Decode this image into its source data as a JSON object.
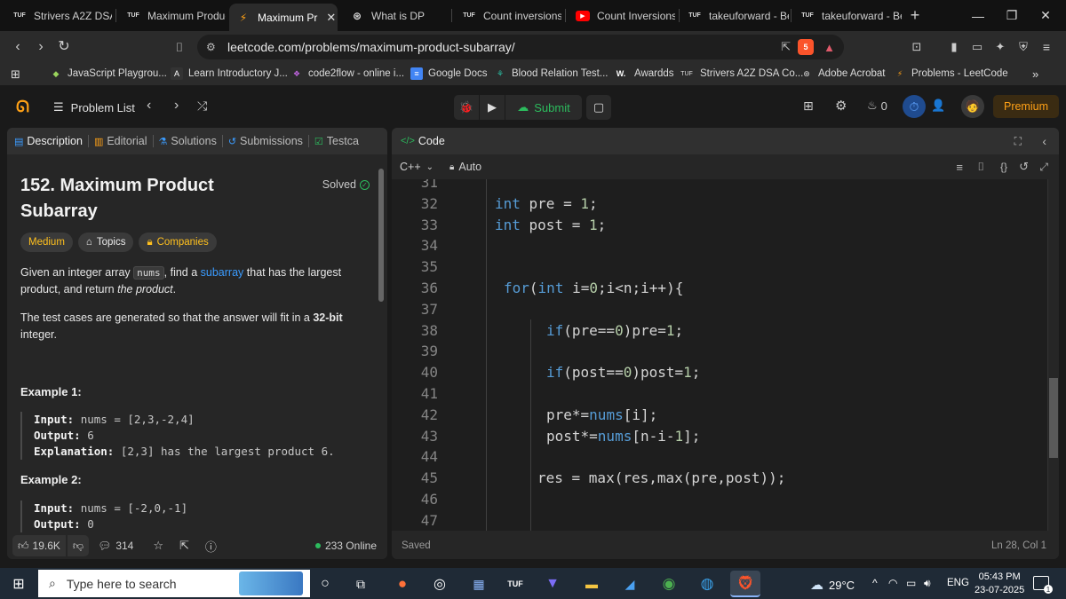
{
  "browser": {
    "tabs": [
      {
        "label": "Strivers A2Z DSA C",
        "favicon": "TUF"
      },
      {
        "label": "Maximum Produc",
        "favicon": "TUF"
      },
      {
        "label": "Maximum Pr",
        "favicon": "leetcode",
        "active": true
      },
      {
        "label": "What is DP",
        "favicon": "chatgpt"
      },
      {
        "label": "Count inversions",
        "favicon": "TUF"
      },
      {
        "label": "Count Inversions",
        "favicon": "youtube"
      },
      {
        "label": "takeuforward - Be",
        "favicon": "TUF"
      },
      {
        "label": "takeuforward - Be",
        "favicon": "TUF"
      }
    ],
    "tab_close": "✕",
    "new_tab": "+",
    "window_controls": {
      "minimize": "—",
      "restore": "❐",
      "close": "✕"
    },
    "url": "leetcode.com/problems/maximum-product-subarray/",
    "brave_badge": "5",
    "bookmarks": [
      {
        "label": "JavaScript Playgrou...",
        "icon": "js"
      },
      {
        "label": "Learn Introductory J...",
        "icon": "A"
      },
      {
        "label": "code2flow - online i...",
        "icon": "c2f"
      },
      {
        "label": "Google Docs",
        "icon": "docs"
      },
      {
        "label": "Blood Relation Test...",
        "icon": "br"
      },
      {
        "label": "Awardds",
        "icon": "W."
      },
      {
        "label": "Strivers A2Z DSA Co...",
        "icon": "TUF"
      },
      {
        "label": "Adobe Acrobat",
        "icon": "acrobat"
      },
      {
        "label": "Problems - LeetCode",
        "icon": "leetcode"
      }
    ],
    "bookmarks_more": "»"
  },
  "lc_header": {
    "problem_list": "Problem List",
    "submit": "Submit",
    "fire_count": "0",
    "premium": "Premium"
  },
  "left_panel": {
    "tabs": [
      {
        "label": "Description",
        "icon": "description"
      },
      {
        "label": "Editorial",
        "icon": "book"
      },
      {
        "label": "Solutions",
        "icon": "flask"
      },
      {
        "label": "Submissions",
        "icon": "history"
      },
      {
        "label": "Testca",
        "icon": "check"
      }
    ],
    "title_line1": "152. Maximum Product",
    "title_line2": "Subarray",
    "solved": "Solved",
    "tags": {
      "difficulty": "Medium",
      "topics": "Topics",
      "companies": "Companies"
    },
    "desc_p1_a": "Given an integer array ",
    "desc_p1_code": "nums",
    "desc_p1_b": ", find a ",
    "desc_p1_link": "subarray",
    "desc_p1_c": " that has the largest",
    "desc_p1_d": "product, and return ",
    "desc_p1_e": "the product",
    "desc_p1_f": ".",
    "desc_p2_a": "The test cases are generated so that the answer will fit in a ",
    "desc_p2_b": "32-bit",
    "desc_p2_c": "integer.",
    "example1": {
      "title": "Example 1:",
      "input_label": "Input:",
      "input_value": "nums = [2,3,-2,4]",
      "output_label": "Output:",
      "output_value": "6",
      "explanation_label": "Explanation:",
      "explanation_value": "[2,3] has the largest product 6."
    },
    "example2": {
      "title": "Example 2:",
      "input_label": "Input:",
      "input_value": "nums = [-2,0,-1]",
      "output_label": "Output:",
      "output_value": "0"
    },
    "footer": {
      "likes": "19.6K",
      "comments": "314",
      "online": "233 Online"
    }
  },
  "right_panel": {
    "tab": "Code",
    "language": "C++",
    "mode": "Auto",
    "status": "Saved",
    "cursor": "Ln 28, Col 1",
    "code_lines": [
      {
        "n": "31",
        "text": ""
      },
      {
        "n": "32",
        "text": "int pre = 1;"
      },
      {
        "n": "33",
        "text": "int post = 1;"
      },
      {
        "n": "34",
        "text": ""
      },
      {
        "n": "35",
        "text": ""
      },
      {
        "n": "36",
        "text": "for(int i=0;i<n;i++){"
      },
      {
        "n": "37",
        "text": ""
      },
      {
        "n": "38",
        "text": "if(pre==0)pre=1;"
      },
      {
        "n": "39",
        "text": ""
      },
      {
        "n": "40",
        "text": "if(post==0)post=1;"
      },
      {
        "n": "41",
        "text": ""
      },
      {
        "n": "42",
        "text": "pre*=nums[i];"
      },
      {
        "n": "43",
        "text": "post*=nums[n-i-1];"
      },
      {
        "n": "44",
        "text": ""
      },
      {
        "n": "45",
        "text": "res = max(res,max(pre,post));"
      },
      {
        "n": "46",
        "text": ""
      },
      {
        "n": "47",
        "text": ""
      }
    ]
  },
  "taskbar": {
    "search_placeholder": "Type here to search",
    "weather": "29°C",
    "language": "ENG",
    "time": "05:43 PM",
    "date": "23-07-2025",
    "notification_count": "1"
  },
  "colors": {
    "accent_green": "#2cbb5d",
    "difficulty_medium": "#ffc01e",
    "link_blue": "#3b9cff",
    "premium": "#ffa116",
    "keyword": "#569cd6",
    "number": "#b5cea8"
  }
}
